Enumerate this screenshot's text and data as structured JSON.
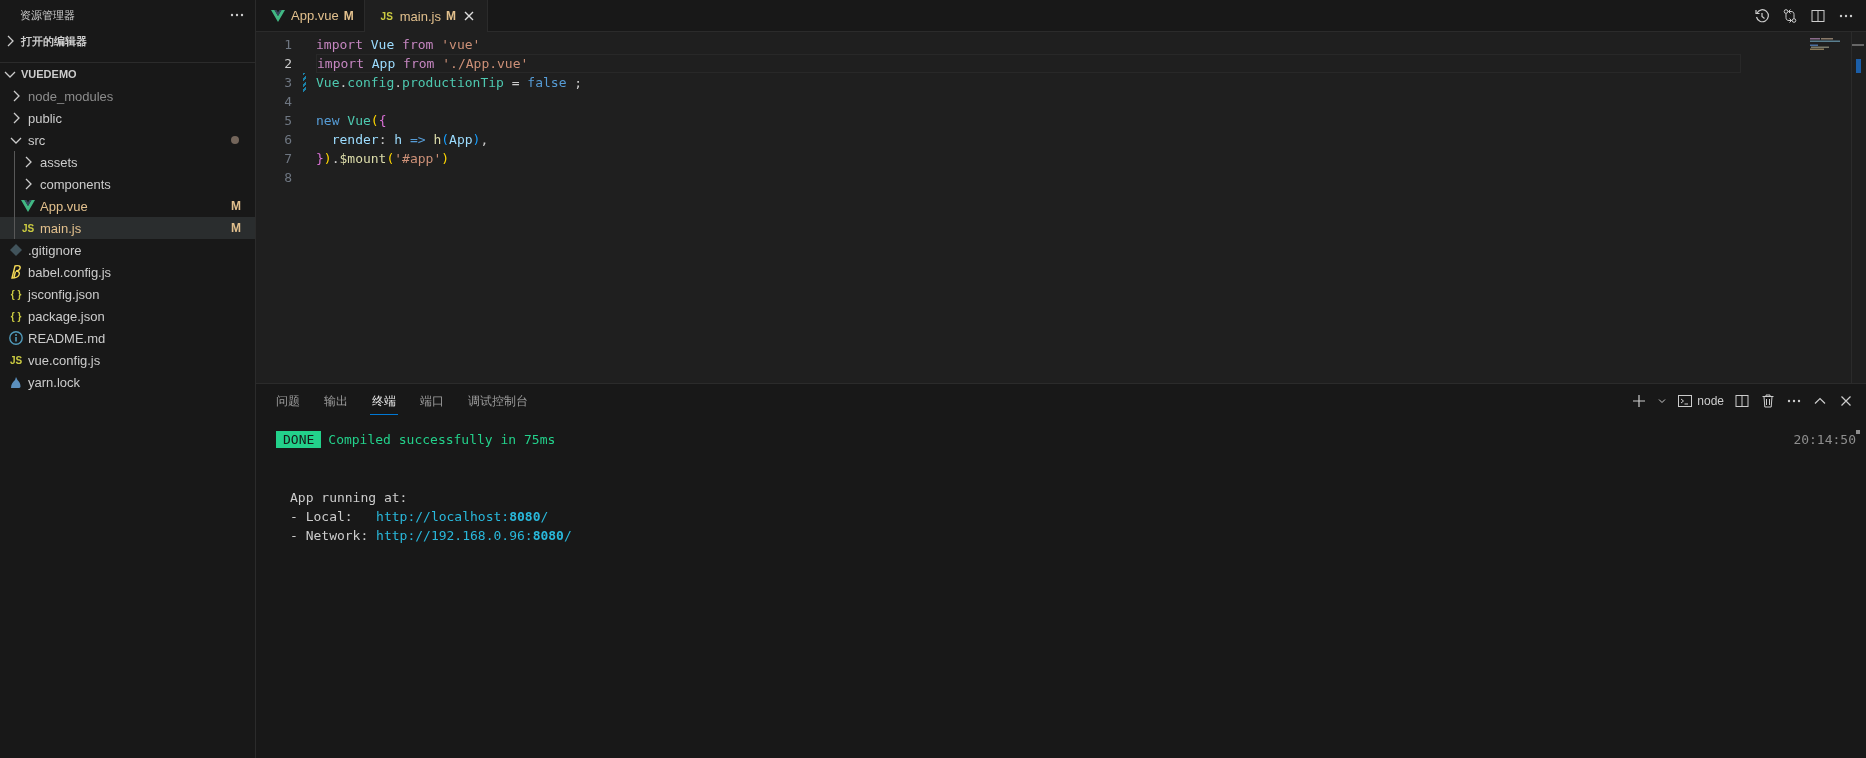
{
  "sidebar": {
    "title": "资源管理器",
    "sections": [
      {
        "title": "打开的编辑器",
        "expanded": false
      },
      {
        "title": "VUEDEMO",
        "expanded": true,
        "items": [
          {
            "name": "node_modules",
            "kind": "folder",
            "expanded": false,
            "ignored": true,
            "selected": false,
            "dot": false
          },
          {
            "name": "public",
            "kind": "folder",
            "expanded": false,
            "ignored": false,
            "selected": false,
            "dot": false
          },
          {
            "name": "src",
            "kind": "folder",
            "expanded": true,
            "ignored": false,
            "selected": false,
            "dot": true,
            "children": [
              {
                "name": "assets",
                "kind": "folder",
                "expanded": false,
                "ignored": false,
                "selected": false,
                "dot": false
              },
              {
                "name": "components",
                "kind": "folder",
                "expanded": false,
                "ignored": false,
                "selected": false,
                "dot": false
              },
              {
                "name": "App.vue",
                "kind": "vue",
                "badge": "M",
                "ignored": false,
                "selected": false,
                "dot": false
              },
              {
                "name": "main.js",
                "kind": "labelled",
                "icon_label": "JS",
                "badge": "M",
                "ignored": false,
                "selected": true,
                "dot": false
              }
            ]
          },
          {
            "name": ".gitignore",
            "kind": "git",
            "ignored": false,
            "selected": false,
            "dot": false
          },
          {
            "name": "babel.config.js",
            "kind": "babel",
            "ignored": false,
            "selected": false,
            "dot": false
          },
          {
            "name": "jsconfig.json",
            "kind": "labelled",
            "icon_label": "{ }",
            "ignored": false,
            "selected": false,
            "dot": false
          },
          {
            "name": "package.json",
            "kind": "labelled",
            "icon_label": "{ }",
            "ignored": false,
            "selected": false,
            "dot": false
          },
          {
            "name": "README.md",
            "kind": "info",
            "ignored": false,
            "selected": false,
            "dot": false
          },
          {
            "name": "vue.config.js",
            "kind": "labelled",
            "icon_label": "JS",
            "ignored": false,
            "selected": false,
            "dot": false
          },
          {
            "name": "yarn.lock",
            "kind": "yarn",
            "ignored": false,
            "selected": false,
            "dot": false
          }
        ]
      }
    ]
  },
  "tabs": [
    {
      "name": "App.vue",
      "kind": "vue",
      "badge": "M",
      "selected": false
    },
    {
      "name": "main.js",
      "kind": "labelled",
      "icon_label": "JS",
      "badge": "M",
      "selected": true
    }
  ],
  "code": [
    {
      "number": "1",
      "current": false,
      "modified": false,
      "tokens": [
        {
          "t": "import",
          "kind": "kw"
        },
        {
          "t": " Vue",
          "kind": "var"
        },
        {
          "t": " from",
          "kind": "kw"
        },
        {
          "t": " 'vue'",
          "kind": "str"
        }
      ]
    },
    {
      "number": "2",
      "current": true,
      "modified": false,
      "tokens": [
        {
          "t": "import",
          "kind": "kw"
        },
        {
          "t": " App",
          "kind": "var"
        },
        {
          "t": " from",
          "kind": "kw"
        },
        {
          "t": " './App.vue'",
          "kind": "str"
        }
      ]
    },
    {
      "number": "3",
      "current": false,
      "modified": true,
      "tokens": [
        {
          "t": "Vue",
          "kind": "cls"
        },
        {
          "t": "."
        },
        {
          "t": "config",
          "kind": "cls"
        },
        {
          "t": "."
        },
        {
          "t": "productionTip",
          "kind": "cls"
        },
        {
          "t": " = "
        },
        {
          "t": "false",
          "kind": "bool"
        },
        {
          "t": " ;"
        }
      ]
    },
    {
      "number": "4",
      "current": false,
      "modified": false
    },
    {
      "number": "5",
      "current": false,
      "modified": false,
      "tokens": [
        {
          "t": "new",
          "kind": "bool"
        },
        {
          "t": " Vue",
          "kind": "cls"
        },
        {
          "t": "(",
          "kind": "b1"
        },
        {
          "t": "{",
          "kind": "b2"
        }
      ]
    },
    {
      "number": "6",
      "current": false,
      "modified": false,
      "tokens": [
        {
          "t": "  render",
          "kind": "var"
        },
        {
          "t": ": "
        },
        {
          "t": "h",
          "kind": "var"
        },
        {
          "t": " =>",
          "kind": "bool"
        },
        {
          "t": " h",
          "kind": "fn"
        },
        {
          "t": "(",
          "kind": "b3"
        },
        {
          "t": "App",
          "kind": "var"
        },
        {
          "t": ")",
          "kind": "b3"
        },
        {
          "t": ","
        }
      ]
    },
    {
      "number": "7",
      "current": false,
      "modified": false,
      "tokens": [
        {
          "t": "}",
          "kind": "b2"
        },
        {
          "t": ")",
          "kind": "b1"
        },
        {
          "t": "."
        },
        {
          "t": "$mount",
          "kind": "fn"
        },
        {
          "t": "(",
          "kind": "b1"
        },
        {
          "t": "'#app'",
          "kind": "str"
        },
        {
          "t": ")",
          "kind": "b1"
        }
      ]
    },
    {
      "number": "8",
      "current": false,
      "modified": false
    }
  ],
  "panel": {
    "tabs": [
      {
        "label": "问题",
        "selected": false
      },
      {
        "label": "输出",
        "selected": false
      },
      {
        "label": "终端",
        "selected": true
      },
      {
        "label": "端口",
        "selected": false
      },
      {
        "label": "调试控制台",
        "selected": false
      }
    ],
    "shell": "node",
    "terminal": {
      "badge": "DONE",
      "message": "Compiled successfully in 75ms",
      "time": "20:14:50",
      "heading": "App running at:",
      "lines": [
        {
          "label": "- Local:   ",
          "url": "http://localhost:**8080**/"
        },
        {
          "label": "- Network: ",
          "url": "http://192.168.0.96:**8080**/"
        }
      ]
    }
  }
}
